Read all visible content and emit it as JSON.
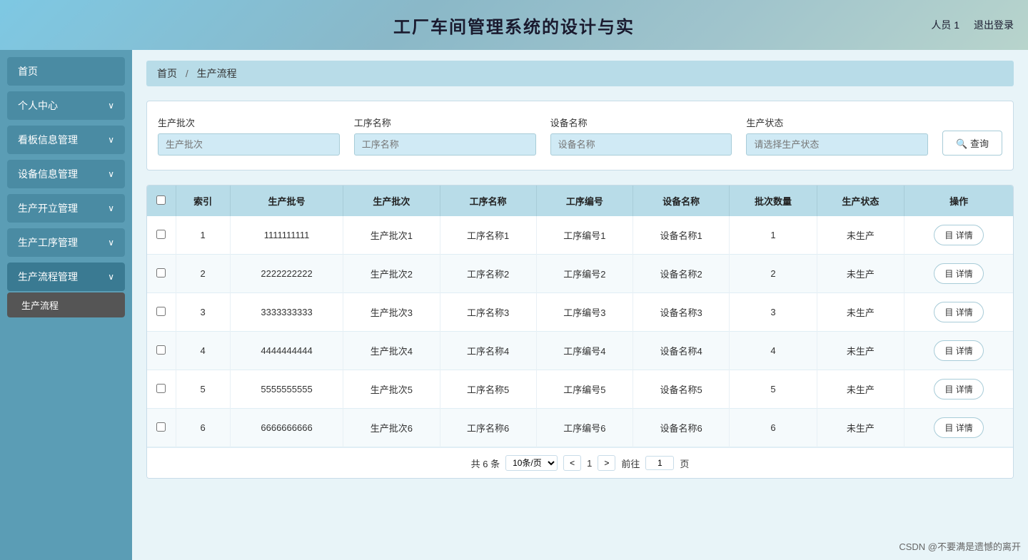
{
  "header": {
    "title": "工厂车间管理系统的设计与实",
    "user": "人员 1",
    "logout": "退出登录"
  },
  "sidebar": {
    "items": [
      {
        "id": "home",
        "label": "首页",
        "hasChildren": false
      },
      {
        "id": "personal",
        "label": "个人中心",
        "hasChildren": true
      },
      {
        "id": "kanban",
        "label": "看板信息管理",
        "hasChildren": true
      },
      {
        "id": "equipment",
        "label": "设备信息管理",
        "hasChildren": true
      },
      {
        "id": "production-open",
        "label": "生产开立管理",
        "hasChildren": true
      },
      {
        "id": "production-process",
        "label": "生产工序管理",
        "hasChildren": true
      },
      {
        "id": "production-flow",
        "label": "生产流程管理",
        "hasChildren": true,
        "active": true
      }
    ],
    "sub_items": {
      "production-flow": [
        {
          "id": "production-flow-sub",
          "label": "生产流程",
          "active": true
        }
      ]
    }
  },
  "breadcrumb": {
    "home": "首页",
    "separator": "/",
    "current": "生产流程"
  },
  "search": {
    "fields": [
      {
        "id": "batch",
        "label": "生产批次",
        "placeholder": "生产批次"
      },
      {
        "id": "process-name",
        "label": "工序名称",
        "placeholder": "工序名称"
      },
      {
        "id": "device-name",
        "label": "设备名称",
        "placeholder": "设备名称"
      },
      {
        "id": "status",
        "label": "生产状态",
        "placeholder": "请选择生产状态"
      }
    ],
    "button": "查询"
  },
  "table": {
    "headers": [
      "",
      "索引",
      "生产批号",
      "生产批次",
      "工序名称",
      "工序编号",
      "设备名称",
      "批次数量",
      "生产状态",
      "操作"
    ],
    "rows": [
      {
        "index": 1,
        "batch_no": "1111111111",
        "batch": "生产批次1",
        "process_name": "工序名称1",
        "process_no": "工序编号1",
        "device": "设备名称1",
        "quantity": 1,
        "status": "未生产"
      },
      {
        "index": 2,
        "batch_no": "2222222222",
        "batch": "生产批次2",
        "process_name": "工序名称2",
        "process_no": "工序编号2",
        "device": "设备名称2",
        "quantity": 2,
        "status": "未生产"
      },
      {
        "index": 3,
        "batch_no": "3333333333",
        "batch": "生产批次3",
        "process_name": "工序名称3",
        "process_no": "工序编号3",
        "device": "设备名称3",
        "quantity": 3,
        "status": "未生产"
      },
      {
        "index": 4,
        "batch_no": "4444444444",
        "batch": "生产批次4",
        "process_name": "工序名称4",
        "process_no": "工序编号4",
        "device": "设备名称4",
        "quantity": 4,
        "status": "未生产"
      },
      {
        "index": 5,
        "batch_no": "5555555555",
        "batch": "生产批次5",
        "process_name": "工序名称5",
        "process_no": "工序编号5",
        "device": "设备名称5",
        "quantity": 5,
        "status": "未生产"
      },
      {
        "index": 6,
        "batch_no": "6666666666",
        "batch": "生产批次6",
        "process_name": "工序名称6",
        "process_no": "工序编号6",
        "device": "设备名称6",
        "quantity": 6,
        "status": "未生产"
      }
    ],
    "detail_btn": "目 详情"
  },
  "pagination": {
    "total": "共 6 条",
    "page_size": "10条/页",
    "prev": "<",
    "next": ">",
    "current_page": "1",
    "go_to": "前往",
    "page_unit": "页"
  },
  "watermark": "CSDN @不要满是遗憾的离开"
}
